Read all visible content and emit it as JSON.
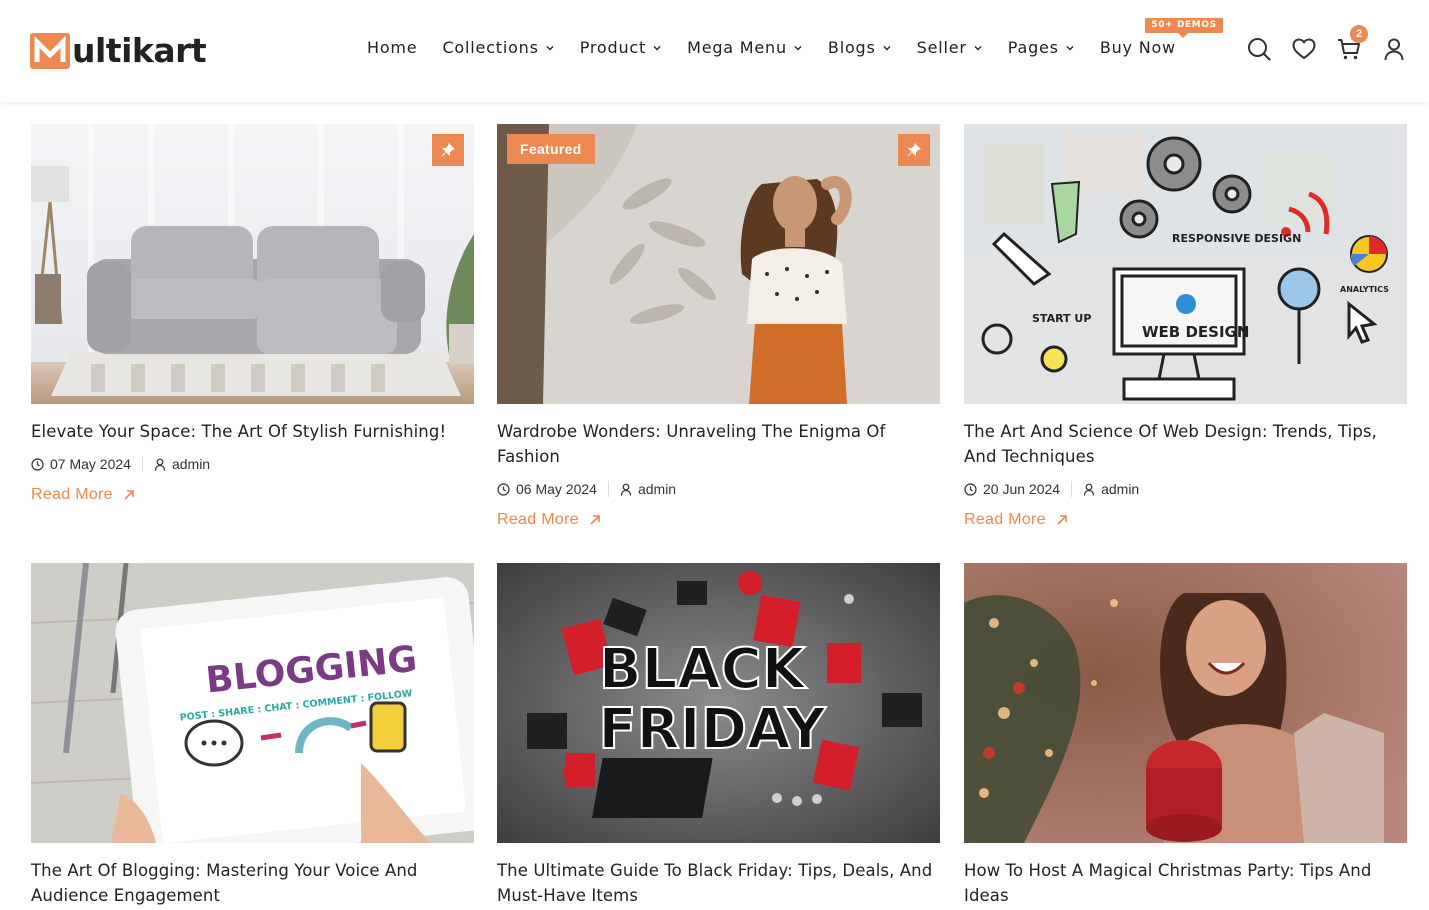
{
  "brand": {
    "logo_letter": "M",
    "logo_text": "ultikart"
  },
  "nav": {
    "items": [
      {
        "label": "Home"
      },
      {
        "label": "Collections"
      },
      {
        "label": "Product"
      },
      {
        "label": "Mega Menu"
      },
      {
        "label": "Blogs"
      },
      {
        "label": "Seller"
      },
      {
        "label": "Pages"
      },
      {
        "label": "Buy Now"
      }
    ],
    "demos_badge": "50+ DEMOS"
  },
  "header_icons": [
    "search-icon",
    "heart-icon",
    "cart-icon",
    "user-icon"
  ],
  "cart_count": "2",
  "colors": {
    "accent": "#ec8951",
    "text": "#222222"
  },
  "posts": [
    {
      "title": "Elevate Your Space: The Art Of Stylish Furnishing!",
      "date": "07 May 2024",
      "author": "admin",
      "read_more": "Read More",
      "featured": "",
      "pinned": true
    },
    {
      "title": "Wardrobe Wonders: Unraveling The Enigma Of Fashion",
      "date": "06 May 2024",
      "author": "admin",
      "read_more": "Read More",
      "featured": "Featured",
      "pinned": true
    },
    {
      "title": "The Art And Science Of Web Design: Trends, Tips, And Techniques",
      "date": "20 Jun 2024",
      "author": "admin",
      "read_more": "Read More",
      "featured": "",
      "pinned": false
    },
    {
      "title": "The Art Of Blogging: Mastering Your Voice And Audience Engagement",
      "featured": "",
      "pinned": false
    },
    {
      "title": "The Ultimate Guide To Black Friday: Tips, Deals, And Must-Have Items",
      "featured": "",
      "pinned": false
    },
    {
      "title": "How To Host A Magical Christmas Party: Tips And Ideas",
      "featured": "",
      "pinned": false
    }
  ],
  "image_text": {
    "web_design": [
      "RESPONSIVE DESIGN",
      "ANALYTICS",
      "START UP",
      "WEB DESIGN"
    ],
    "blogging": [
      "BLOGGING",
      "POST : SHARE : CHAT : COMMENT : FOLLOW"
    ],
    "black_friday": [
      "BLACK",
      "FRIDAY"
    ]
  }
}
